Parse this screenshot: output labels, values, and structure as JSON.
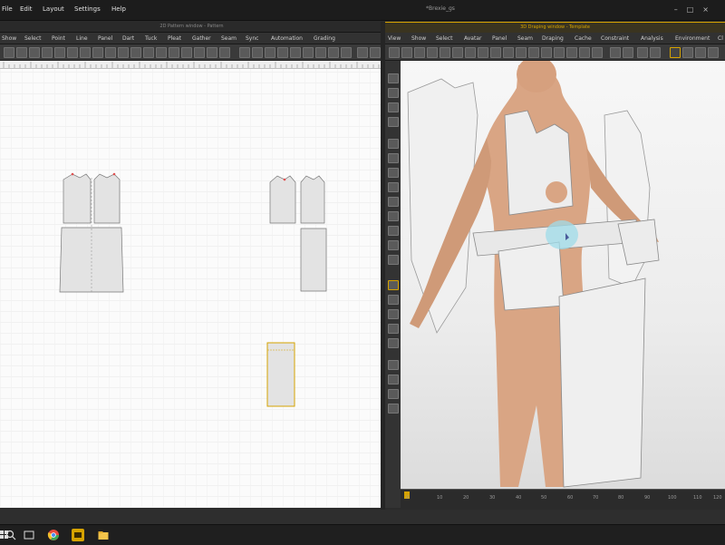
{
  "app": {
    "document_title": "*Brexie_gs",
    "menu": [
      "File",
      "Edit",
      "Layout",
      "Settings",
      "Help"
    ]
  },
  "panels": {
    "pattern_2d": {
      "title": "2D Pattern window - Pattern",
      "menu": [
        "Show",
        "Select",
        "Point",
        "Line",
        "Panel",
        "Dart",
        "Tuck",
        "Pleat",
        "Gather",
        "Seam",
        "Sync",
        "Automation",
        "Grading"
      ]
    },
    "draping_3d": {
      "title": "3D Draping window - Template",
      "menu": [
        "View",
        "Show",
        "Select",
        "Avatar",
        "Panel",
        "Seam",
        "Draping",
        "Cache",
        "Constraint",
        "Analysis",
        "Environment",
        "Cl"
      ]
    }
  },
  "timeline": {
    "ticks": [
      "0",
      "10",
      "20",
      "30",
      "40",
      "50",
      "60",
      "70",
      "80",
      "90",
      "100",
      "110",
      "120"
    ]
  },
  "colors": {
    "accent": "#d6a300",
    "panel_dark": "#2b2b2b",
    "pattern_fill": "#e3e3e3",
    "skin": "#d9a584",
    "selection": "#9fdcea"
  },
  "taskbar": {
    "icons": [
      "windows-start-icon",
      "search-icon",
      "task-view-icon",
      "chrome-icon",
      "app-icon",
      "file-explorer-icon"
    ]
  }
}
